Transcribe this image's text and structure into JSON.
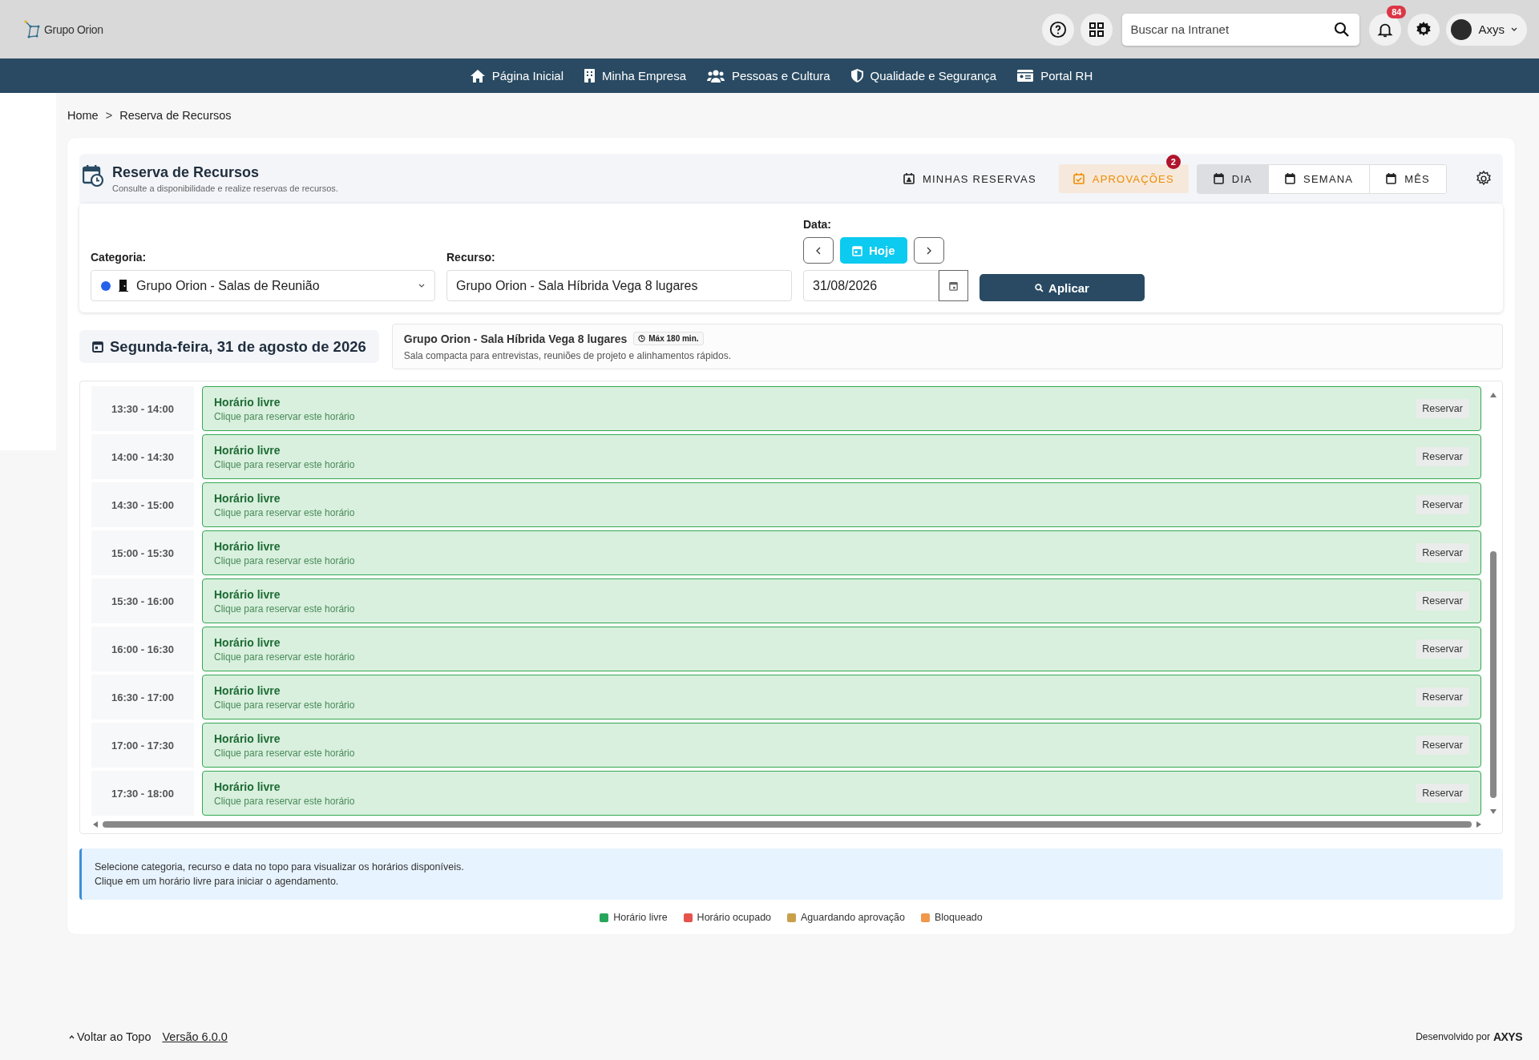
{
  "header": {
    "logo": "Grupo Orion",
    "search": {
      "placeholder": "Buscar na Intranet"
    },
    "notifications": "84",
    "user": "Axys"
  },
  "nav": [
    {
      "label": "Página Inicial"
    },
    {
      "label": "Minha Empresa"
    },
    {
      "label": "Pessoas e Cultura"
    },
    {
      "label": "Qualidade e Segurança"
    },
    {
      "label": "Portal RH"
    }
  ],
  "breadcrumb": {
    "separator": ">",
    "items": [
      "Home",
      "Reserva de Recursos"
    ]
  },
  "page": {
    "title": "Reserva de Recursos",
    "subtitle": "Consulte a disponibilidade e realize reservas de recursos."
  },
  "actions": [
    {
      "label": "MINHAS RESERVAS",
      "kind": "plain"
    },
    {
      "label": "APROVAÇÕES",
      "kind": "highlight",
      "badge": "2"
    }
  ],
  "views": [
    {
      "label": "DIA",
      "selected": true
    },
    {
      "label": "SEMANA",
      "selected": false
    },
    {
      "label": "MÊS",
      "selected": false
    }
  ],
  "filters": {
    "category_label": "Categoria:",
    "category": "Grupo Orion - Salas de Reunião",
    "resource_label": "Recurso:",
    "resource": "Grupo Orion - Sala Híbrida Vega 8 lugares",
    "date_label": "Data:",
    "today": "Hoje",
    "date": "31/08/2026",
    "apply": "Aplicar"
  },
  "day_heading": "Segunda-feira, 31 de agosto de 2026",
  "resource_info": {
    "name": "Grupo Orion - Sala Híbrida Vega 8 lugares",
    "limit": "Máx 180 min.",
    "description": "Sala compacta para entrevistas, reuniões de projeto e alinhamentos rápidos."
  },
  "slots": [
    {
      "time": "13:30 - 14:00",
      "kind": "free",
      "title": "Horário livre",
      "hint": "Clique para reservar este horário",
      "action": "Reservar"
    },
    {
      "time": "14:00 - 14:30",
      "kind": "free",
      "title": "Horário livre",
      "hint": "Clique para reservar este horário",
      "action": "Reservar"
    },
    {
      "time": "14:30 - 15:00",
      "kind": "free",
      "title": "Horário livre",
      "hint": "Clique para reservar este horário",
      "action": "Reservar"
    },
    {
      "time": "15:00 - 15:30",
      "kind": "free",
      "title": "Horário livre",
      "hint": "Clique para reservar este horário",
      "action": "Reservar"
    },
    {
      "time": "15:30 - 16:00",
      "kind": "free",
      "title": "Horário livre",
      "hint": "Clique para reservar este horário",
      "action": "Reservar"
    },
    {
      "time": "16:00 - 16:30",
      "kind": "free",
      "title": "Horário livre",
      "hint": "Clique para reservar este horário",
      "action": "Reservar"
    },
    {
      "time": "16:30 - 17:00",
      "kind": "free",
      "title": "Horário livre",
      "hint": "Clique para reservar este horário",
      "action": "Reservar"
    },
    {
      "time": "17:00 - 17:30",
      "kind": "free",
      "title": "Horário livre",
      "hint": "Clique para reservar este horário",
      "action": "Reservar"
    },
    {
      "time": "17:30 - 18:00",
      "kind": "free",
      "title": "Horário livre",
      "hint": "Clique para reservar este horário",
      "action": "Reservar"
    }
  ],
  "info": [
    "Selecione categoria, recurso e data no topo para visualizar os horários disponíveis.",
    "Clique em um horário livre para iniciar o agendamento."
  ],
  "legend": [
    {
      "label": "Horário livre",
      "color": "#27a55a"
    },
    {
      "label": "Horário ocupado",
      "color": "#e5534b"
    },
    {
      "label": "Aguardando aprovação",
      "color": "#c9a04a"
    },
    {
      "label": "Bloqueado",
      "color": "#f0974a"
    }
  ],
  "footer": {
    "back_to_top": "Voltar ao Topo",
    "version": "Versão 6.0.0",
    "credit": "Desenvolvido por",
    "brand": "AXYS"
  }
}
